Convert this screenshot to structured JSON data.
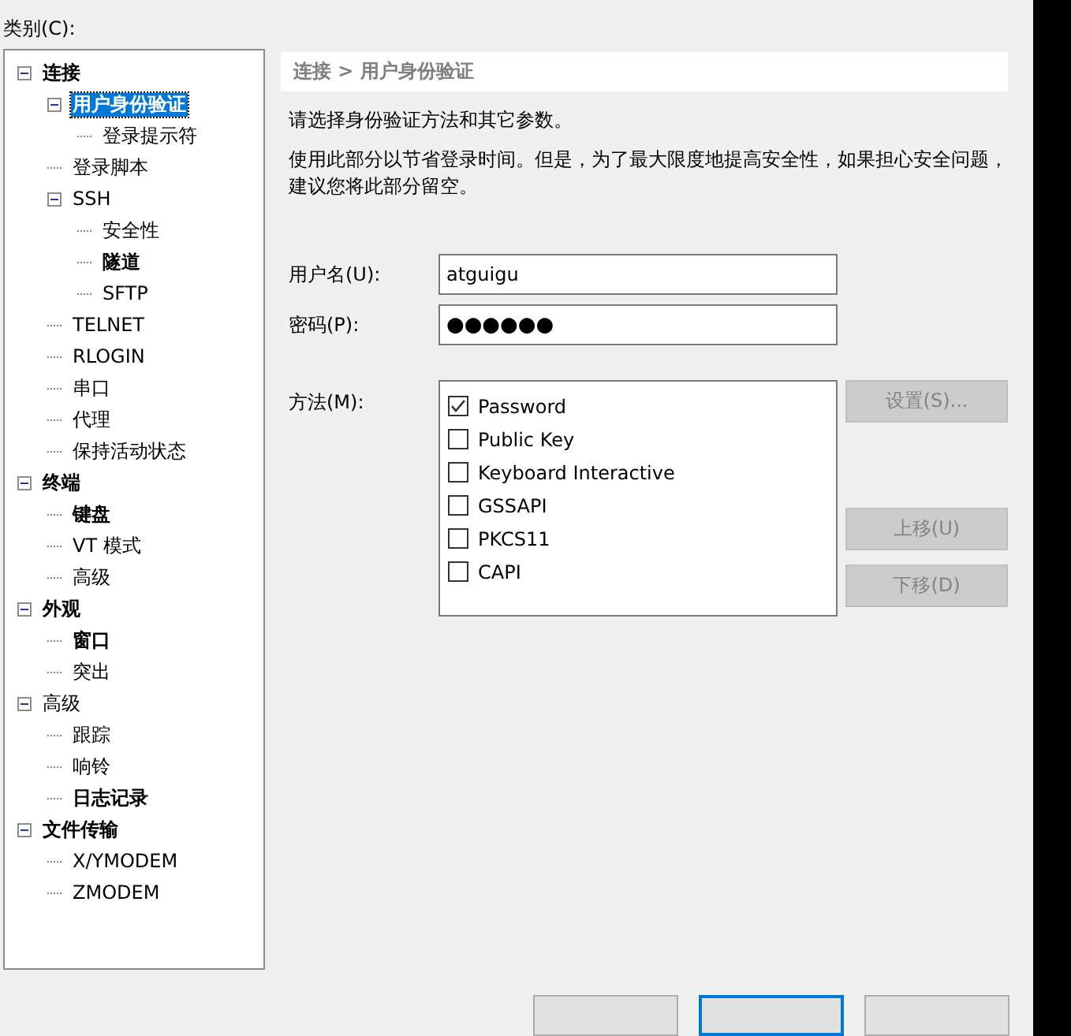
{
  "category_label": "类别(C):",
  "tree": [
    {
      "label": "连接",
      "bold": true,
      "selected": false,
      "expanded": true,
      "children": [
        {
          "label": "用户身份验证",
          "bold": true,
          "selected": true,
          "expanded": true,
          "children": [
            {
              "label": "登录提示符",
              "bold": false,
              "selected": false
            }
          ]
        },
        {
          "label": "登录脚本",
          "bold": false,
          "selected": false
        },
        {
          "label": "SSH",
          "bold": false,
          "selected": false,
          "expanded": true,
          "children": [
            {
              "label": "安全性",
              "bold": false,
              "selected": false
            },
            {
              "label": "隧道",
              "bold": true,
              "selected": false
            },
            {
              "label": "SFTP",
              "bold": false,
              "selected": false
            }
          ]
        },
        {
          "label": "TELNET",
          "bold": false,
          "selected": false
        },
        {
          "label": "RLOGIN",
          "bold": false,
          "selected": false
        },
        {
          "label": "串口",
          "bold": false,
          "selected": false
        },
        {
          "label": "代理",
          "bold": false,
          "selected": false
        },
        {
          "label": "保持活动状态",
          "bold": false,
          "selected": false
        }
      ]
    },
    {
      "label": "终端",
      "bold": true,
      "selected": false,
      "expanded": true,
      "children": [
        {
          "label": "键盘",
          "bold": true,
          "selected": false
        },
        {
          "label": "VT 模式",
          "bold": false,
          "selected": false
        },
        {
          "label": "高级",
          "bold": false,
          "selected": false
        }
      ]
    },
    {
      "label": "外观",
      "bold": true,
      "selected": false,
      "expanded": true,
      "children": [
        {
          "label": "窗口",
          "bold": true,
          "selected": false
        },
        {
          "label": "突出",
          "bold": false,
          "selected": false
        }
      ]
    },
    {
      "label": "高级",
      "bold": false,
      "selected": false,
      "expanded": true,
      "children": [
        {
          "label": "跟踪",
          "bold": false,
          "selected": false
        },
        {
          "label": "响铃",
          "bold": false,
          "selected": false
        },
        {
          "label": "日志记录",
          "bold": true,
          "selected": false
        }
      ]
    },
    {
      "label": "文件传输",
      "bold": true,
      "selected": false,
      "expanded": true,
      "children": [
        {
          "label": "X/YMODEM",
          "bold": false,
          "selected": false
        },
        {
          "label": "ZMODEM",
          "bold": false,
          "selected": false
        }
      ]
    }
  ],
  "breadcrumb": "连接 > 用户身份验证",
  "intro": "请选择身份验证方法和其它参数。",
  "note": "使用此部分以节省登录时间。但是，为了最大限度地提高安全性，如果担心安全问题，建议您将此部分留空。",
  "username": {
    "label": "用户名(U):",
    "value": "atguigu"
  },
  "password": {
    "label": "密码(P):",
    "value": "●●●●●●"
  },
  "methods": {
    "label": "方法(M):",
    "items": [
      {
        "label": "Password",
        "checked": true
      },
      {
        "label": "Public Key",
        "checked": false
      },
      {
        "label": "Keyboard Interactive",
        "checked": false
      },
      {
        "label": "GSSAPI",
        "checked": false
      },
      {
        "label": "PKCS11",
        "checked": false
      },
      {
        "label": "CAPI",
        "checked": false
      }
    ]
  },
  "settings_button": {
    "label": "设置(S)...",
    "disabled": true
  },
  "move_buttons": [
    {
      "label": "上移(U)",
      "disabled": true
    },
    {
      "label": "下移(D)",
      "disabled": true
    }
  ],
  "footer_buttons": [
    {
      "default": false
    },
    {
      "default": true
    },
    {
      "default": false
    }
  ]
}
